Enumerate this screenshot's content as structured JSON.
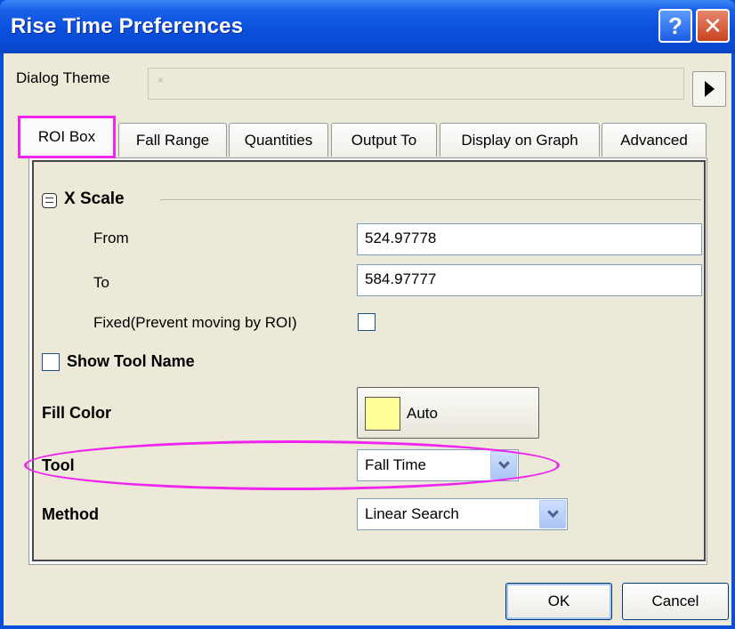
{
  "window": {
    "title": "Rise Time Preferences",
    "help_glyph": "?",
    "close_glyph": "✕"
  },
  "theme": {
    "label": "Dialog Theme",
    "value": "",
    "placeholder_mark": "×"
  },
  "tabs": [
    {
      "label": "ROI Box",
      "active": true
    },
    {
      "label": "Fall Range"
    },
    {
      "label": "Quantities"
    },
    {
      "label": "Output To"
    },
    {
      "label": "Display on Graph"
    },
    {
      "label": "Advanced"
    }
  ],
  "x_scale": {
    "title": "X Scale",
    "from_label": "From",
    "from_value": "524.97778",
    "to_label": "To",
    "to_value": "584.97777",
    "fixed_label": "Fixed(Prevent moving by ROI)",
    "fixed_checked": false
  },
  "show_tool_name": {
    "label": "Show Tool Name",
    "checked": false
  },
  "fill_color": {
    "label": "Fill Color",
    "value": "Auto",
    "swatch": "#ffff99"
  },
  "tool": {
    "label": "Tool",
    "value": "Fall Time"
  },
  "method": {
    "label": "Method",
    "value": "Linear Search"
  },
  "buttons": {
    "ok": "OK",
    "cancel": "Cancel"
  },
  "colors": {
    "title_bar": "#0a4fd8",
    "dialog_bg": "#ece9d8",
    "highlight": "#f024ef",
    "swatch": "#ffff99"
  }
}
